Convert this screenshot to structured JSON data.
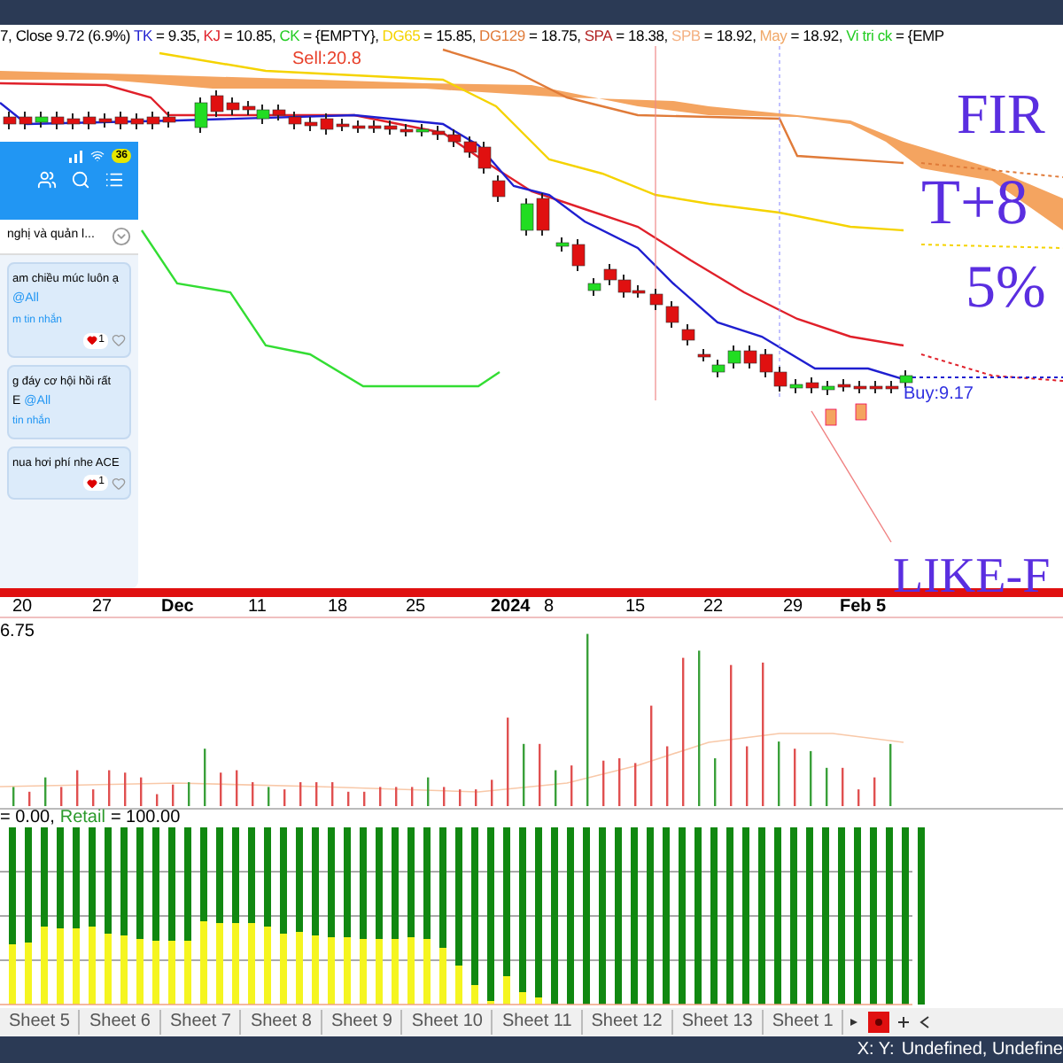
{
  "header": {
    "prefix": "7, Close 9.72 (6.9%)",
    "indicators": [
      {
        "name": "TK",
        "color": "#1f1fd0",
        "value": "= 9.35,"
      },
      {
        "name": "KJ",
        "color": "#e0202a",
        "value": "= 10.85,"
      },
      {
        "name": "CK",
        "color": "#22cc22",
        "value": "= {EMPTY},"
      },
      {
        "name": "DG65",
        "color": "#f5d300",
        "value": "= 15.85,"
      },
      {
        "name": "DG129",
        "color": "#e07b39",
        "value": "= 18.75,"
      },
      {
        "name": "SPA",
        "color": "#b22222",
        "value": "= 18.38,"
      },
      {
        "name": "SPB",
        "color": "#f4b183",
        "value": "= 18.92,"
      },
      {
        "name": "May",
        "color": "#f0a868",
        "value": "= 18.92,"
      },
      {
        "name": "Vi tri ck",
        "color": "#22cc22",
        "value": "= {EMP"
      }
    ]
  },
  "main_chart": {
    "sell_label": "Sell:20.8",
    "buy_label": "Buy:9.17"
  },
  "overlay_texts": [
    "FIR",
    "T+8",
    "5%",
    "LIKE-F"
  ],
  "phone": {
    "battery": "36",
    "pinned": "nghị và quản l...",
    "messages": [
      {
        "line": "am chiều múc luôn ạ",
        "mention": "@All",
        "footer": "m tin nhắn",
        "reaction": "1"
      },
      {
        "line": "g đáy cơ hội hồi rất",
        "mention_prefix": "E",
        "mention": "@All",
        "footer": "tin nhắn"
      },
      {
        "line": "nua hơi phí nhe ACE",
        "reaction": "1"
      }
    ]
  },
  "date_axis": [
    {
      "label": "20",
      "bold": false
    },
    {
      "label": "27",
      "bold": false
    },
    {
      "label": "Dec",
      "bold": true
    },
    {
      "label": "11",
      "bold": false
    },
    {
      "label": "18",
      "bold": false
    },
    {
      "label": "25",
      "bold": false
    },
    {
      "label": "2024",
      "bold": true
    },
    {
      "label": "8",
      "bold": false
    },
    {
      "label": "15",
      "bold": false
    },
    {
      "label": "22",
      "bold": false
    },
    {
      "label": "29",
      "bold": false
    },
    {
      "label": "Feb 5",
      "bold": true
    }
  ],
  "volume": {
    "max_label": "6.75"
  },
  "retail": {
    "prefix": "= 0.00,",
    "name": "Retail",
    "value": "= 100.00"
  },
  "sheet_tabs": [
    "Sheet 5",
    "Sheet 6",
    "Sheet 7",
    "Sheet 8",
    "Sheet 9",
    "Sheet 10",
    "Sheet 11",
    "Sheet 12",
    "Sheet 13",
    "Sheet 1"
  ],
  "status_bar": {
    "coords": "X: Y:",
    "text": "Undefined, Undefine"
  }
}
